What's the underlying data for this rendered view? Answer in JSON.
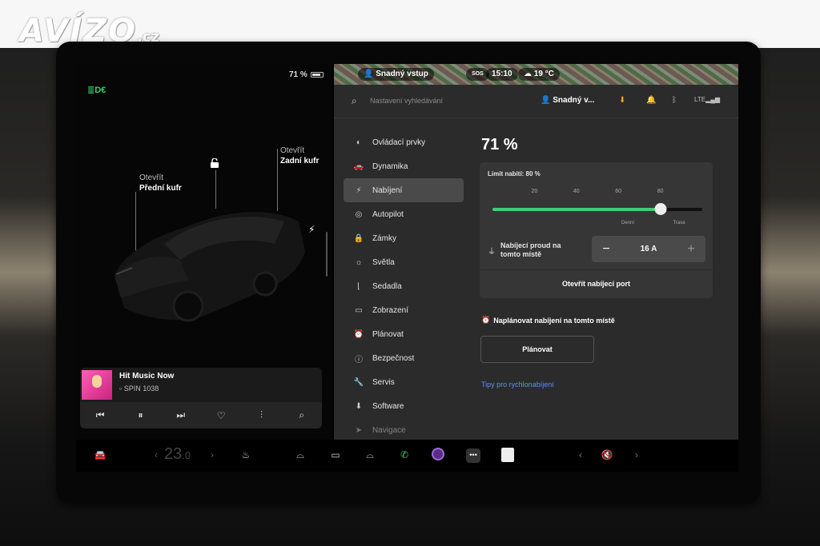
{
  "watermark": {
    "brand": "AVÍZO",
    "suffix": ".cz"
  },
  "status": {
    "battery_pct": "71 %",
    "profile": "Snadný vstup",
    "sos": "SOS",
    "time": "15:10",
    "temp": "19 °C"
  },
  "car": {
    "front_trunk": {
      "action": "Otevřít",
      "name": "Přední kufr"
    },
    "rear_trunk": {
      "action": "Otevřít",
      "name": "Zadní kufr"
    }
  },
  "media": {
    "title": "Hit Music Now",
    "source": "SPIN 1038"
  },
  "search": {
    "placeholder": "Nastavení vyhledávání",
    "user": "Snadný v..."
  },
  "nav": [
    {
      "label": "Ovládací prvky",
      "icon": "toggle-icon"
    },
    {
      "label": "Dynamika",
      "icon": "car-icon"
    },
    {
      "label": "Nabíjení",
      "icon": "bolt-icon",
      "active": true
    },
    {
      "label": "Autopilot",
      "icon": "steering-wheel-icon"
    },
    {
      "label": "Zámky",
      "icon": "lock-icon"
    },
    {
      "label": "Světla",
      "icon": "sun-icon"
    },
    {
      "label": "Sedadla",
      "icon": "seat-icon"
    },
    {
      "label": "Zobrazení",
      "icon": "display-icon"
    },
    {
      "label": "Plánovat",
      "icon": "alarm-icon"
    },
    {
      "label": "Bezpečnost",
      "icon": "info-icon"
    },
    {
      "label": "Servis",
      "icon": "wrench-icon"
    },
    {
      "label": "Software",
      "icon": "download-icon"
    },
    {
      "label": "Navigace",
      "icon": "navigation-icon"
    }
  ],
  "charging": {
    "battery_level": "71 %",
    "limit_label": "Limit nabití: 80 %",
    "limit_fraction": 0.8,
    "current_fraction": 0.71,
    "ticks": [
      "20",
      "40",
      "60",
      "80"
    ],
    "daily_label": "Denní",
    "trip_label": "Trasa",
    "current_label": "Nabíjecí proud na tomto místě",
    "current_value": "16 A",
    "open_port": "Otevřít nabíjecí port",
    "schedule_heading": "Naplánovat nabíjení na tomto místě",
    "schedule_button": "Plánovat",
    "tips_link": "Tipy pro rychlonabíjení"
  },
  "dock": {
    "temperature": "23",
    "temperature_decimal": ".0"
  }
}
